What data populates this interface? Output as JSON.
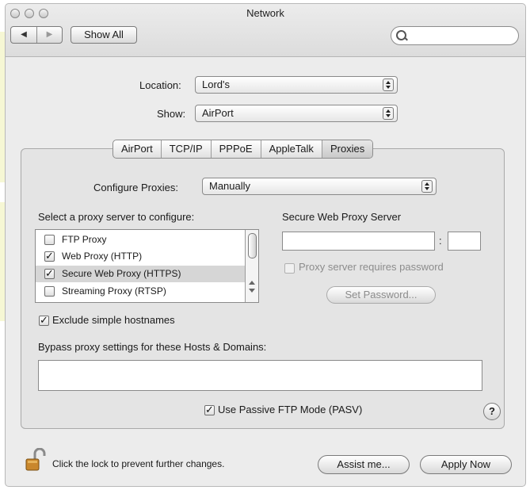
{
  "window": {
    "title": "Network",
    "toolbar": {
      "show_all_label": "Show All",
      "search_placeholder": ""
    }
  },
  "location": {
    "label": "Location:",
    "value": "Lord's"
  },
  "show": {
    "label": "Show:",
    "value": "AirPort"
  },
  "tabs": [
    {
      "label": "AirPort",
      "selected": false
    },
    {
      "label": "TCP/IP",
      "selected": false
    },
    {
      "label": "PPPoE",
      "selected": false
    },
    {
      "label": "AppleTalk",
      "selected": false
    },
    {
      "label": "Proxies",
      "selected": true
    }
  ],
  "proxies": {
    "configure_label": "Configure Proxies:",
    "configure_value": "Manually",
    "select_label": "Select a proxy server to configure:",
    "list": [
      {
        "label": "FTP Proxy",
        "checked": false
      },
      {
        "label": "Web Proxy (HTTP)",
        "checked": true
      },
      {
        "label": "Secure Web Proxy (HTTPS)",
        "checked": true,
        "selected": true
      },
      {
        "label": "Streaming Proxy (RTSP)",
        "checked": false
      }
    ],
    "server_heading": "Secure Web Proxy Server",
    "server_host": "",
    "server_port": "",
    "port_separator": ":",
    "password_required_label": "Proxy server requires password",
    "set_password_label": "Set Password...",
    "exclude_simple_label": "Exclude simple hostnames",
    "exclude_simple_checked": true,
    "bypass_label": "Bypass proxy settings for these Hosts & Domains:",
    "bypass_value": "",
    "passive_ftp_label": "Use Passive FTP Mode (PASV)",
    "passive_ftp_checked": true,
    "help_label": "?"
  },
  "footer": {
    "lock_text": "Click the lock to prevent further changes.",
    "assist_label": "Assist me...",
    "apply_label": "Apply Now"
  },
  "icons": {
    "checkmark": "✓",
    "lock": "lock-icon",
    "search": "search-icon",
    "back": "◀",
    "forward": "▶"
  }
}
